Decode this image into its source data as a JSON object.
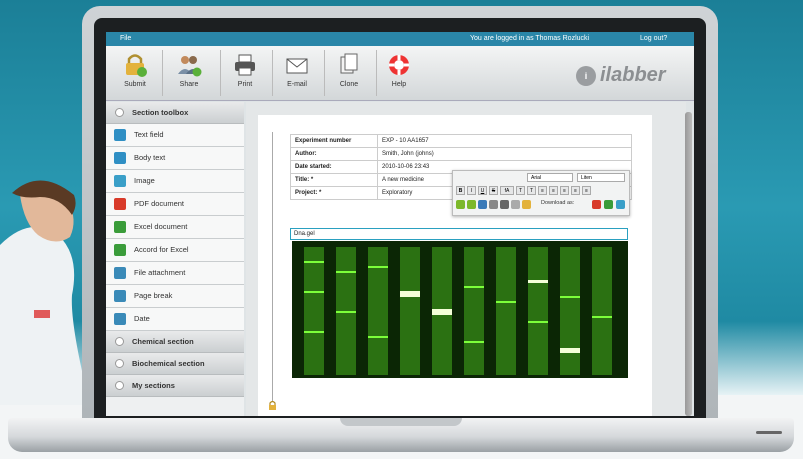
{
  "topbar": {
    "file_menu": "File",
    "user_text": "You are logged in as Thomas Rozlucki",
    "logout": "Log out?"
  },
  "toolbar": {
    "buttons": [
      {
        "label": "Submit",
        "icon": "lock-check-icon"
      },
      {
        "label": "Share",
        "icon": "users-add-icon"
      },
      {
        "label": "Print",
        "icon": "printer-icon"
      },
      {
        "label": "E-mail",
        "icon": "envelope-icon"
      },
      {
        "label": "Clone",
        "icon": "copy-icon"
      },
      {
        "label": "Help",
        "icon": "lifebuoy-icon"
      }
    ],
    "logo_text": "ilabber",
    "logo_mark": "i"
  },
  "sidebar": {
    "section_toolbox": "Section toolbox",
    "items": [
      {
        "label": "Text field",
        "color": "#2f8fc4"
      },
      {
        "label": "Body text",
        "color": "#2f8fc4"
      },
      {
        "label": "Image",
        "color": "#3a9fc8"
      },
      {
        "label": "PDF document",
        "color": "#d83a2a"
      },
      {
        "label": "Excel document",
        "color": "#3a9c3a"
      },
      {
        "label": "Accord for Excel",
        "color": "#3a9c3a"
      },
      {
        "label": "File attachment",
        "color": "#3a8ab8"
      },
      {
        "label": "Page break",
        "color": "#3a8ab8"
      },
      {
        "label": "Date",
        "color": "#3a8ab8"
      }
    ],
    "chemical_section": "Chemical section",
    "biochemical_section": "Biochemical section",
    "my_sections": "My sections"
  },
  "document": {
    "meta": [
      {
        "key": "Experiment number",
        "value": "EXP - 10 AA1657"
      },
      {
        "key": "Author:",
        "value": "Smith, John (johns)"
      },
      {
        "key": "Date started:",
        "value": "2010-10-06 23:43"
      },
      {
        "key": "Title: *",
        "value": "A new medicine"
      },
      {
        "key": "Project: *",
        "value": "Exploratory"
      }
    ],
    "format_toolbar": {
      "font_select": "Arial",
      "size_select": "Liten",
      "download_label": "Download as:",
      "buttons": [
        "B",
        "I",
        "U",
        "S",
        "fA",
        "T",
        "T",
        "≡",
        "≡",
        "≡",
        "≡",
        "≡"
      ]
    },
    "image_title": "Dna.gel"
  },
  "colors": {
    "accent": "#2a86a8",
    "gel_band": "#7cff3a"
  }
}
